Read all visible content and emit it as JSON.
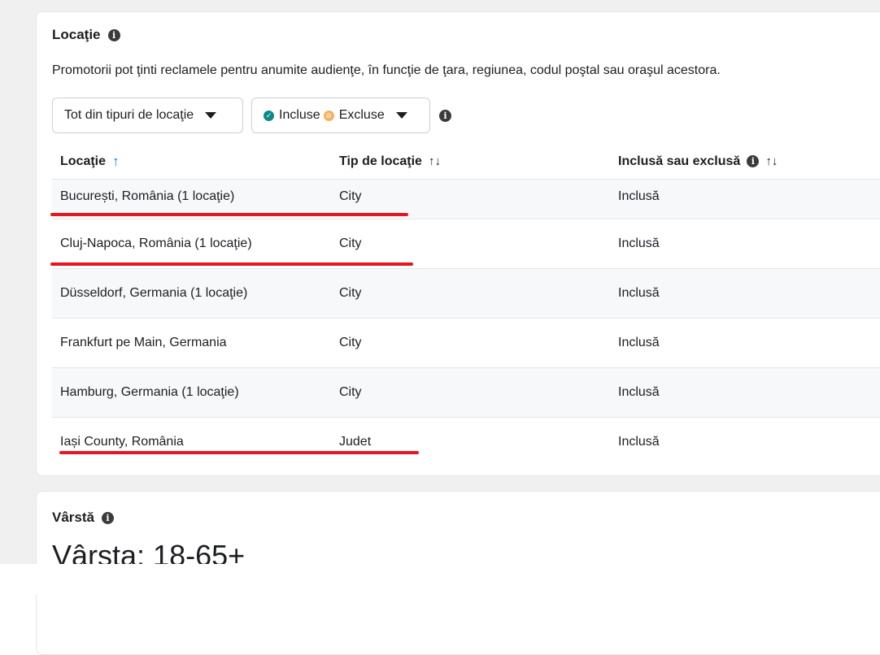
{
  "location_section": {
    "title": "Locaţie",
    "description": "Promotorii pot ţinti reclamele pentru anumite audienţe, în funcţie de ţara, regiunea, codul poştal sau oraşul acestora.",
    "filter_type_label": "Tot din tipuri de locaţie",
    "filter_included_label": "Incluse",
    "filter_excluded_label": "Excluse",
    "columns": {
      "location": "Locaţie",
      "type": "Tip de locaţie",
      "status": "Inclusă sau exclusă"
    },
    "rows": [
      {
        "location": "București, România (1 locaţie)",
        "type": "City",
        "status": "Inclusă"
      },
      {
        "location": "Cluj-Napoca, România (1 locaţie)",
        "type": "City",
        "status": "Inclusă"
      },
      {
        "location": "Düsseldorf, Germania (1 locaţie)",
        "type": "City",
        "status": "Inclusă"
      },
      {
        "location": "Frankfurt pe Main, Germania",
        "type": "City",
        "status": "Inclusă"
      },
      {
        "location": "Hamburg, Germania (1 locaţie)",
        "type": "City",
        "status": "Inclusă"
      },
      {
        "location": "Iași County, România",
        "type": "Judet",
        "status": "Inclusă"
      }
    ]
  },
  "age_section": {
    "title": "Vârstă",
    "value": "Vârsta: 18-65+"
  },
  "colors": {
    "accent": "#1877f2",
    "included": "#0b8a8a",
    "excluded": "#f5b259",
    "annotation": "#e4171e"
  }
}
